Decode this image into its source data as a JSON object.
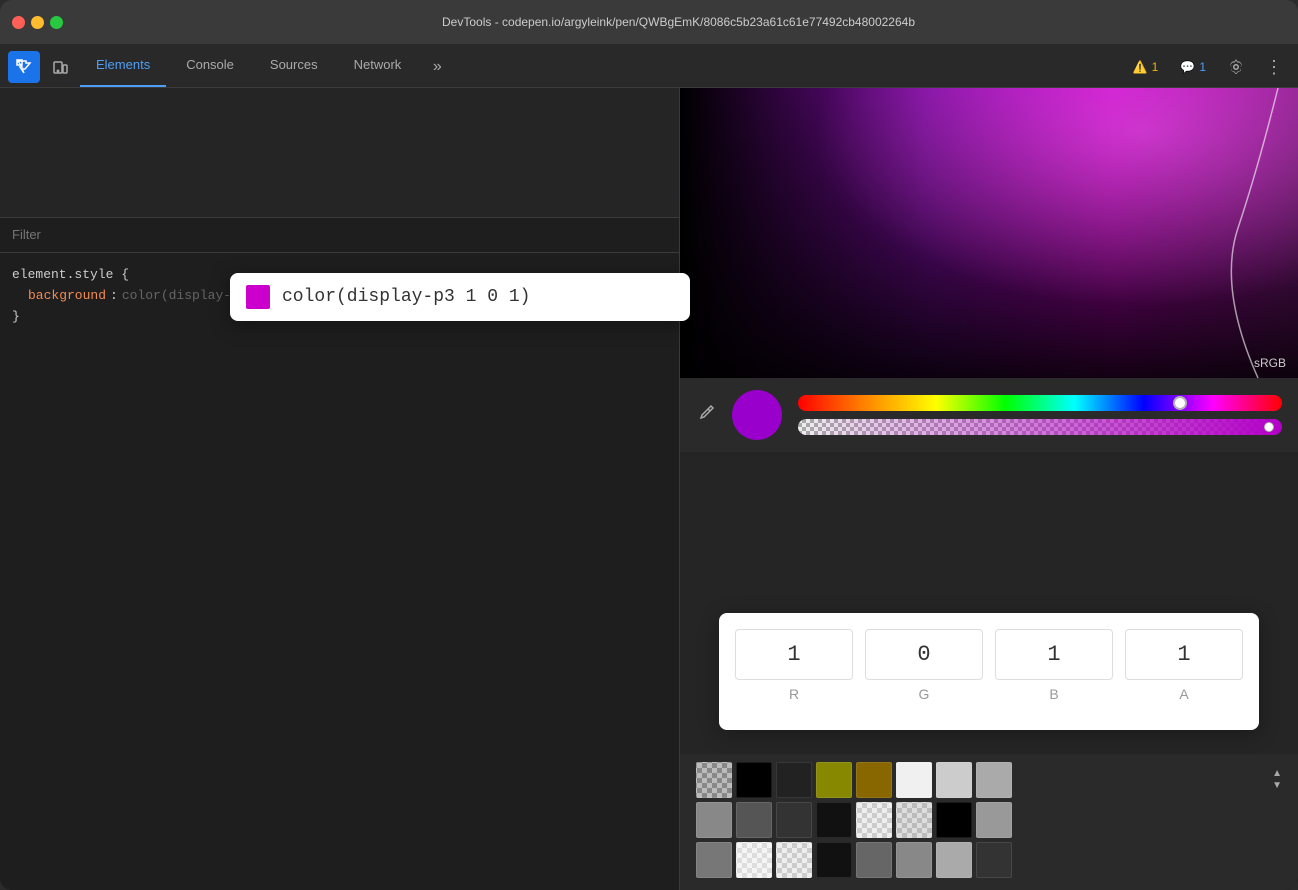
{
  "window": {
    "title": "DevTools - codepen.io/argyleink/pen/QWBgEmK/8086c5b23a61c61e77492cb48002264b"
  },
  "toolbar": {
    "tabs": [
      {
        "id": "elements",
        "label": "Elements",
        "active": true
      },
      {
        "id": "console",
        "label": "Console",
        "active": false
      },
      {
        "id": "sources",
        "label": "Sources",
        "active": false
      },
      {
        "id": "network",
        "label": "Network",
        "active": false
      }
    ],
    "more_tabs_icon": "»",
    "warnings_count": "1",
    "messages_count": "1"
  },
  "filter": {
    "placeholder": "Filter",
    "label": "Filter"
  },
  "css": {
    "selector": "element.style {",
    "property": "background",
    "value": "color(display-p3 1 0 1);",
    "close": "}"
  },
  "color_tooltip": {
    "swatch_color": "#cc00cc",
    "text": "color(display-p3 1 0 1)"
  },
  "color_picker": {
    "srgb_label": "sRGB",
    "eyedropper_icon": "✒",
    "circle_color": "#9900cc",
    "rgba": {
      "r": {
        "value": "1",
        "label": "R"
      },
      "g": {
        "value": "0",
        "label": "G"
      },
      "b": {
        "value": "1",
        "label": "B"
      },
      "a": {
        "value": "1",
        "label": "A"
      }
    }
  },
  "swatches": {
    "row1": [
      {
        "color": "#5a5aaa",
        "type": "checkered"
      },
      {
        "color": "#000000"
      },
      {
        "color": "#222222"
      },
      {
        "color": "#888800"
      },
      {
        "color": "#886600"
      },
      {
        "color": "#f0f0f0"
      },
      {
        "color": "#cccccc"
      },
      {
        "color": "#aaaaaa"
      }
    ],
    "row2": [
      {
        "color": "#888888"
      },
      {
        "color": "#555555"
      },
      {
        "color": "#333333"
      },
      {
        "color": "#111111"
      },
      {
        "color": "#e0e0e0",
        "type": "checkered2"
      },
      {
        "color": "#d0d0d0",
        "type": "checkered2"
      },
      {
        "color": "#000000"
      },
      {
        "color": "#999999"
      }
    ],
    "row3": [
      {
        "color": "#777777"
      },
      {
        "color": "#eeeeee",
        "type": "light-checkered"
      },
      {
        "color": "#bbbbbb",
        "type": "light-checkered"
      },
      {
        "color": "#111111"
      },
      {
        "color": "#666666"
      },
      {
        "color": "#888888"
      },
      {
        "color": "#aaaaaa"
      },
      {
        "color": "#333333"
      }
    ]
  }
}
